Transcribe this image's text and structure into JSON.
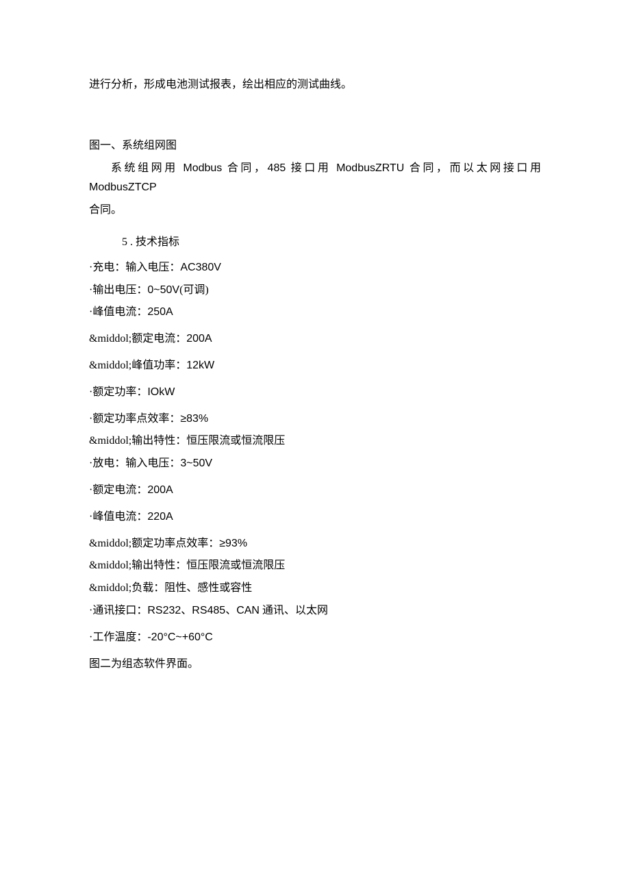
{
  "intro": "进行分析，形成电池测试报表，绘出相应的测试曲线。",
  "fig1_caption": "图一、系统组网图",
  "network_desc_prefix": "系统组网用 ",
  "network_desc_m1": "Modbus",
  "network_desc_mid1": " 合同，",
  "network_desc_m2": "485",
  "network_desc_mid2": " 接口用 ",
  "network_desc_m3": "ModbusZRTU",
  "network_desc_mid3": " 合同，而以太网接口用 ",
  "network_desc_m4": "ModbusZTCP",
  "network_desc_end": "合同。",
  "section5": "5  . 技术指标",
  "spec1_prefix": "&middot;充电：输入电压：",
  "spec1_val": "AC380V",
  "spec2_prefix": "&middot;输出电压：",
  "spec2_val": "0~50V",
  "spec2_suffix": "(可调)",
  "spec3_prefix": "&middot;峰值电流：",
  "spec3_val": "250A",
  "spec4_prefix": "&middol;额定电流：",
  "spec4_val": "200A",
  "spec5_prefix": "&middol;峰值功率：",
  "spec5_val": "12kW",
  "spec6_prefix": "&middot;额定功率：",
  "spec6_val": "IOkW",
  "spec7_prefix": "&middot;额定功率点效率：",
  "spec7_val": "&ge;83%",
  "spec8_prefix": "&middol;输出特性：恒压限流或恒流限压",
  "spec9_prefix": "&middot;放电：输入电压：",
  "spec9_val": "3~50V",
  "spec10_prefix": "&middot;额定电流：",
  "spec10_val": "200A",
  "spec11_prefix": "&middot;峰值电流：",
  "spec11_val": "220A",
  "spec12_prefix": "&middol;额定功率点效率：",
  "spec12_val": "&ge;93%",
  "spec13_prefix": "&middol;输出特性：恒压限流或恒流限压",
  "spec14_prefix": "&middol;负载：阻性、感性或容性",
  "spec15_prefix": "&middot;通讯接口：",
  "spec15_val": "RS232、RS485、CAN",
  "spec15_suffix": " 通讯、以太网",
  "spec16_prefix": "&middot;工作温度：",
  "spec16_val": "-20°C~+60°C",
  "fig2_caption": "图二为组态软件界面。"
}
